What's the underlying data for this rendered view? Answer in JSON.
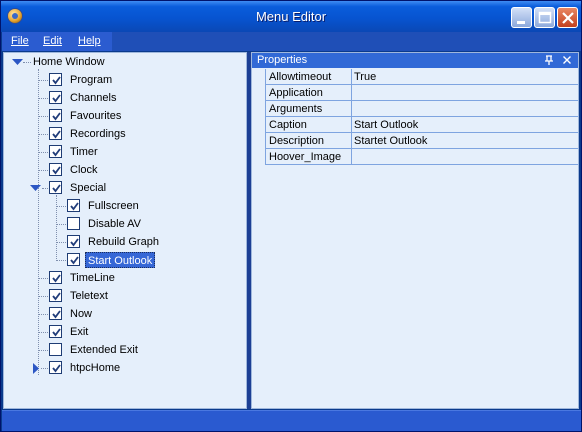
{
  "window": {
    "title": "Menu Editor",
    "app_icon": "mediaportal-globe-icon"
  },
  "menubar": {
    "items": [
      {
        "label": "File"
      },
      {
        "label": "Edit"
      },
      {
        "label": "Help"
      }
    ]
  },
  "tree": {
    "root": {
      "label": "Home Window",
      "expanded": true
    },
    "items": [
      {
        "label": "Program",
        "checked": true,
        "level": 1
      },
      {
        "label": "Channels",
        "checked": true,
        "level": 1
      },
      {
        "label": "Favourites",
        "checked": true,
        "level": 1
      },
      {
        "label": "Recordings",
        "checked": true,
        "level": 1
      },
      {
        "label": "Timer",
        "checked": true,
        "level": 1
      },
      {
        "label": "Clock",
        "checked": true,
        "level": 1
      },
      {
        "label": "Special",
        "checked": true,
        "level": 1,
        "expander": "expanded"
      },
      {
        "label": "Fullscreen",
        "checked": true,
        "level": 2
      },
      {
        "label": "Disable AV",
        "checked": false,
        "level": 2
      },
      {
        "label": "Rebuild Graph",
        "checked": true,
        "level": 2
      },
      {
        "label": "Start Outlook",
        "checked": true,
        "level": 2,
        "selected": true
      },
      {
        "label": "TimeLine",
        "checked": true,
        "level": 1
      },
      {
        "label": "Teletext",
        "checked": true,
        "level": 1
      },
      {
        "label": "Now",
        "checked": true,
        "level": 1
      },
      {
        "label": "Exit",
        "checked": true,
        "level": 1
      },
      {
        "label": "Extended Exit",
        "checked": false,
        "level": 1
      },
      {
        "label": "htpcHome",
        "checked": true,
        "level": 1,
        "expander": "collapsed"
      }
    ]
  },
  "properties": {
    "title": "Properties",
    "rows": [
      {
        "name": "Allowtimeout",
        "value": "True"
      },
      {
        "name": "Application",
        "value": ""
      },
      {
        "name": "Arguments",
        "value": ""
      },
      {
        "name": "Caption",
        "value": "Start Outlook"
      },
      {
        "name": "Description",
        "value": "Startet Outlook"
      },
      {
        "name": "Hoover_Image",
        "value": ""
      }
    ]
  },
  "colors": {
    "accent": "#3169d6",
    "panel_bg": "#e5effb",
    "frame": "#0a3a8c"
  }
}
